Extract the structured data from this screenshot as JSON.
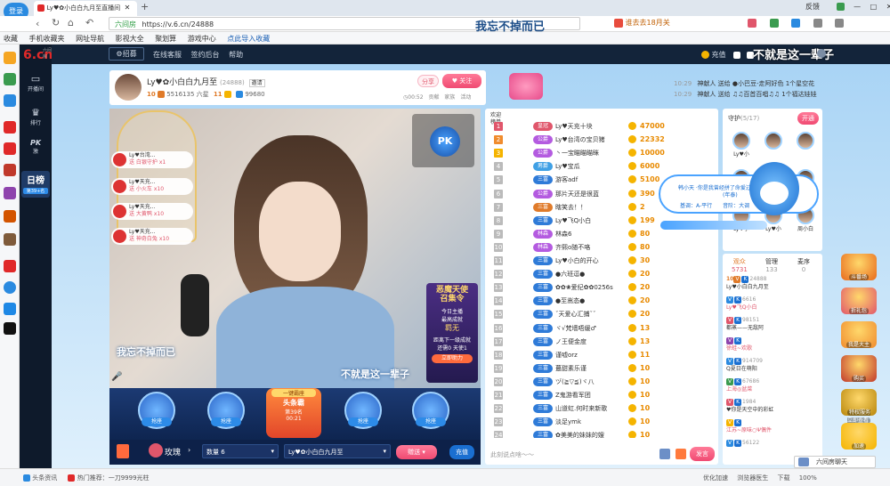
{
  "browser": {
    "login": "登录",
    "tab_title": "Ly♥✿小白白九月至直播间",
    "url": "https://v.6.cn/24888",
    "url_prefix": "六间房",
    "top_overlay": "我忘不掉而已",
    "topright_text": "谁去去18月关",
    "window_labels": [
      "反馈",
      "↓",
      "□",
      "✕"
    ],
    "bookmarks": [
      "收藏",
      "手机收藏夹",
      "网址导航",
      "影视大全",
      "聚划算",
      "游戏中心",
      "点此导入收藏"
    ]
  },
  "site": {
    "logo": "6.cn",
    "logo_sub": "六间房",
    "nav": [
      "开播间",
      "排行",
      "PK"
    ],
    "nav_pk_sub": "激",
    "day_rank": "日榜",
    "day_rank_sub": "第39+名",
    "top_links": [
      "招募",
      "在线客服",
      "签约后台",
      "帮助"
    ],
    "top_right": [
      "充值"
    ],
    "lyric_top": "不就是这一辈子"
  },
  "streamer": {
    "name": "Ly♥✿小白白九月至",
    "room_id": "(24888)",
    "tag": "邀请",
    "level_num": "10",
    "fans": "5516135",
    "fans_unit": "六星",
    "fans_badge": "11",
    "coins": "99680",
    "share": "分享",
    "follow": "关注",
    "clock": "00:52",
    "menu": [
      "贡献",
      "家族",
      "活动"
    ]
  },
  "video": {
    "pk_badge": "PK",
    "lyric_left": "我忘不掉而已",
    "lyric_right": "不就是这一辈子",
    "promo_title": "恶魔天使\n召集令",
    "promo_line1": "今日主播",
    "promo_line2": "最高成就",
    "promo_line3": "羁无",
    "promo_line4": "距离下一级成就",
    "promo_line5": "还需0  天使1",
    "promo_btn": "立即助力",
    "gifts": [
      {
        "user": "Ly♥台湾...",
        "gift": "送 白银守护",
        "count": "x1"
      },
      {
        "user": "Ly♥天充...",
        "gift": "送 小火车",
        "count": "x10"
      },
      {
        "user": "Ly♥天充...",
        "gift": "送 大黄鸭",
        "count": "x10"
      },
      {
        "user": "Ly♥天充...",
        "gift": "送 神奇白兔",
        "count": "x10"
      }
    ]
  },
  "seats": {
    "labels": [
      "抢座",
      "抢座",
      "抢座",
      "抢座"
    ],
    "center_title": "一键霸座",
    "center_sub": "头条霸",
    "center_num": "第39名",
    "center_time": "00:21"
  },
  "giftbar": {
    "label": "玫瑰",
    "qty_label": "数量",
    "qty": "6",
    "target": "Ly♥✿小白白九月至",
    "send": "赠送",
    "recharge": "充值"
  },
  "rank": {
    "tab_top": "欢迎",
    "tab_top_sub": "榜单",
    "rows": [
      {
        "n": "1",
        "lv": "皇冠",
        "name": "Ly♥天充十块",
        "score": "47000",
        "color": "#e0566b"
      },
      {
        "n": "2",
        "lv": "公爵",
        "name": "Ly♥台湾の宝贝猪",
        "score": "22332",
        "color": "#b45be0"
      },
      {
        "n": "3",
        "lv": "公爵",
        "name": "丶一宝瞄瞄瞄眯",
        "score": "10000",
        "color": "#b45be0"
      },
      {
        "n": "4",
        "lv": "男爵",
        "name": "Ly♥宝瓜",
        "score": "6000",
        "color": "#3fa0e5"
      },
      {
        "n": "5",
        "lv": "三富",
        "name": "游客adf",
        "score": "5100",
        "color": "#2f7bd8"
      },
      {
        "n": "6",
        "lv": "公爵",
        "name": "那片天还是很蓝",
        "score": "390",
        "color": "#b45be0"
      },
      {
        "n": "7",
        "lv": "三富",
        "name": "瞎笑去！！",
        "score": "2",
        "color": "#e07b2a"
      },
      {
        "n": "8",
        "lv": "三富",
        "name": "Ly♥飞Q小白",
        "score": "199",
        "color": "#2f7bd8"
      },
      {
        "n": "9",
        "lv": "林森",
        "name": "林森6",
        "score": "80",
        "color": "#b45be0"
      },
      {
        "n": "10",
        "lv": "林森",
        "name": "齐熙o随不咯",
        "score": "80",
        "color": "#b45be0"
      },
      {
        "n": "11",
        "lv": "三富",
        "name": "Ly♥小白的开心",
        "score": "30",
        "color": "#2f7bd8"
      },
      {
        "n": "12",
        "lv": "三富",
        "name": "●六班逗●",
        "score": "20",
        "color": "#2f7bd8"
      },
      {
        "n": "13",
        "lv": "三富",
        "name": "✿✿❀爱纪✿✿0256s",
        "score": "20",
        "color": "#2f7bd8"
      },
      {
        "n": "14",
        "lv": "三富",
        "name": "●至嵩态●",
        "score": "20",
        "color": "#2f7bd8"
      },
      {
        "n": "15",
        "lv": "三富",
        "name": "ˇ天爱心汇捕ˇˇ",
        "score": "20",
        "color": "#2f7bd8"
      },
      {
        "n": "16",
        "lv": "三富",
        "name": "ヾ√梵墙唔缓♂",
        "score": "13",
        "color": "#2f7bd8"
      },
      {
        "n": "17",
        "lv": "三富",
        "name": "ノ王便金度",
        "score": "13",
        "color": "#2f7bd8"
      },
      {
        "n": "18",
        "lv": "三富",
        "name": "谨嘘orz",
        "score": "11",
        "color": "#2f7bd8"
      },
      {
        "n": "19",
        "lv": "三富",
        "name": "蕞甜素乐谨",
        "score": "10",
        "color": "#2f7bd8"
      },
      {
        "n": "20",
        "lv": "三富",
        "name": "ヅ(≧▽≦)ヾ八",
        "score": "10",
        "color": "#2f7bd8"
      },
      {
        "n": "21",
        "lv": "三富",
        "name": "Z鬼游看军团",
        "score": "10",
        "color": "#2f7bd8"
      },
      {
        "n": "22",
        "lv": "三富",
        "name": "山道虹.何时来新歌",
        "score": "10",
        "color": "#2f7bd8"
      },
      {
        "n": "23",
        "lv": "三富",
        "name": "淡足ymk",
        "score": "10",
        "color": "#2f7bd8"
      },
      {
        "n": "24",
        "lv": "三富",
        "name": "✿美美的妹妹的嫂",
        "score": "10",
        "color": "#2f7bd8"
      }
    ],
    "chat_placeholder": "此刻说点啥～～",
    "send": "发言"
  },
  "chat": {
    "lines": [
      {
        "time": "10:29",
        "text": "神献人 送给 ●小巴豆-走阿好色 1个星空花"
      },
      {
        "time": "10:29",
        "text": "神献人 送给 ♫♫百首百唱♫♫ 1个福达娃娃"
      }
    ]
  },
  "guard": {
    "title": "守护",
    "count": "(5/17)",
    "open": "开通",
    "names": [
      "Ly♥小",
      "",
      "",
      "Ly♥小",
      "",
      "",
      "Ly♥小",
      "Ly♥小",
      "周小白"
    ]
  },
  "notice": {
    "line1": "韩小天 ·你是我曾经拼了命爱过的人",
    "line1b": "(年泰)",
    "singer": "基调：A-平行",
    "author": "音阶：大调"
  },
  "userlist": {
    "tabs": [
      "观众",
      "管理",
      "麦序"
    ],
    "tab_counts": [
      "5731",
      "133",
      "0"
    ],
    "users": [
      {
        "lv": "10",
        "name": "24888",
        "sub": "Ly♥小白白九月至"
      },
      {
        "lv": "",
        "name": "6616",
        "sub": "Ly♥飞Q小白"
      },
      {
        "lv": "",
        "name": "98151",
        "sub": "都蒸——无敌阿"
      },
      {
        "lv": "",
        "name": "",
        "sub": "徐蛙~欢歌"
      },
      {
        "lv": "",
        "name": "914709",
        "sub": "Q夏日在萌阳"
      },
      {
        "lv": "",
        "name": "67686",
        "sub": "上海◎盆菜"
      },
      {
        "lv": "",
        "name": "1984",
        "sub": "♥你是天空中的彩虹"
      },
      {
        "lv": "",
        "name": "",
        "sub": "江苏~原味○Ψ偶件"
      },
      {
        "lv": "",
        "name": "56122",
        "sub": ""
      }
    ]
  },
  "rightrail": [
    "斗番场",
    "折礼包",
    "我是大主",
    "购买",
    "特权服务\n立即查看",
    "加速"
  ],
  "floating_chat": "六间房聊天",
  "status": {
    "items": [
      "头条资讯",
      "热门推荐：一刀9999光柱"
    ],
    "right": [
      "优化加速",
      "浏览器医生",
      "下载",
      "100%"
    ]
  }
}
